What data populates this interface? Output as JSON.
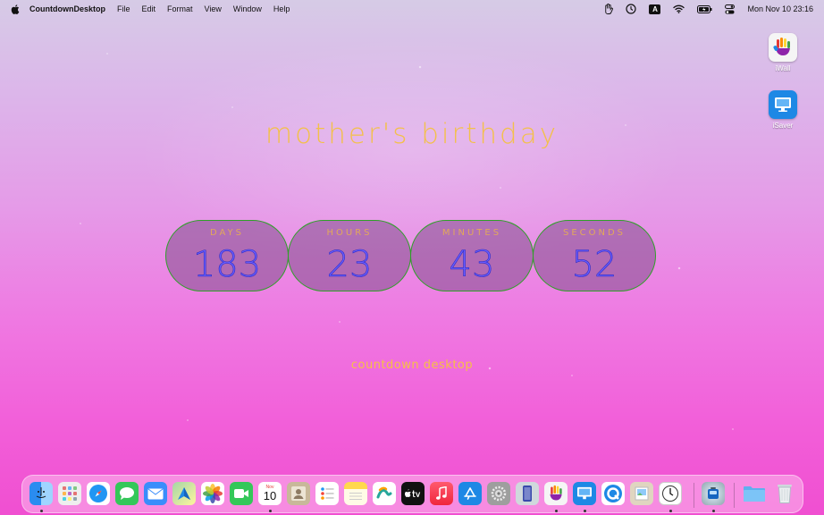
{
  "menubar": {
    "app_name": "CountdownDesktop",
    "items": [
      "File",
      "Edit",
      "Format",
      "View",
      "Window",
      "Help"
    ],
    "status_icons": [
      "hand-icon",
      "clock-icon",
      "input-source-icon",
      "wifi-icon",
      "battery-icon",
      "control-center-icon"
    ],
    "input_source_letter": "A",
    "datetime": "Mon Nov 10  23:16"
  },
  "desktop_icons": [
    {
      "label": "iWall",
      "icon": "hand-paint-icon"
    },
    {
      "label": "iSaver",
      "icon": "monitor-icon"
    }
  ],
  "event_title": "mother's birthday",
  "countdown": [
    {
      "label": "DAYS",
      "value": "183"
    },
    {
      "label": "HOURS",
      "value": "23"
    },
    {
      "label": "MINUTES",
      "value": "43"
    },
    {
      "label": "SECONDS",
      "value": "52"
    }
  ],
  "footer_label": "countdown desktop",
  "dock": {
    "calendar_month": "Nov",
    "calendar_day": "10",
    "apps": [
      "Finder",
      "Launchpad",
      "Safari",
      "Messages",
      "Mail",
      "Maps",
      "Photos",
      "FaceTime",
      "Calendar",
      "Contacts",
      "Reminders",
      "Notes",
      "Freeform",
      "TV",
      "Music",
      "App Store",
      "System Settings",
      "iPhone Mirroring",
      "iWall",
      "iSaver",
      "QuickTime Player",
      "Preview",
      "Clock",
      "CountdownDesktop",
      "Downloads",
      "Trash"
    ]
  },
  "colors": {
    "title": "#f3c04a",
    "counter_border": "#2fa028",
    "counter_digits": "#6b5cff",
    "label": "#e2a85a"
  }
}
